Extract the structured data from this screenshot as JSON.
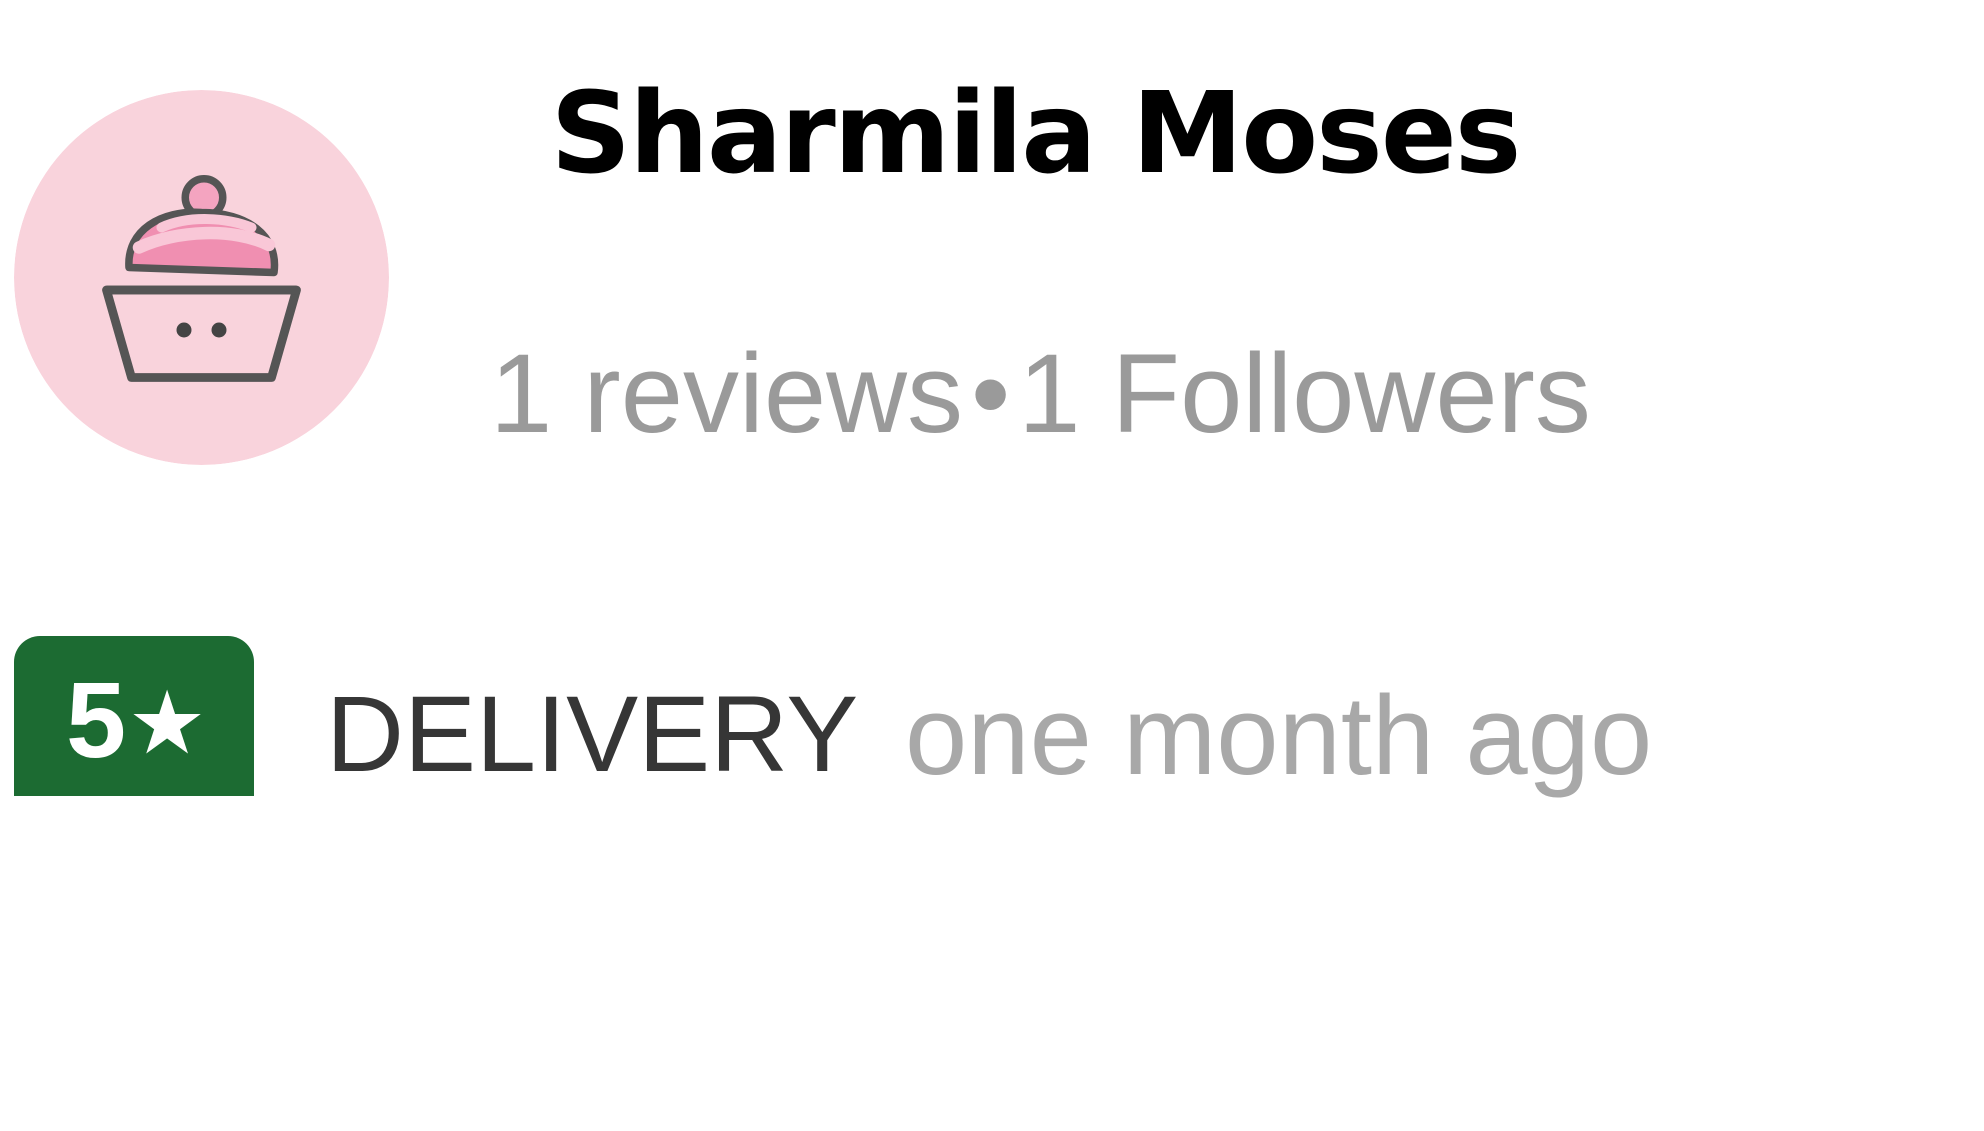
{
  "reviewer": {
    "name": "Sharmila Moses",
    "avatar_icon": "cupcake-icon",
    "stats": {
      "reviews": "1 reviews",
      "separator": "•",
      "followers": "1 Followers"
    }
  },
  "review": {
    "rating_value": "5",
    "rating_icon": "star-icon",
    "rating_color": "#1c6b32",
    "order_type": "DELIVERY",
    "time": "one month ago"
  }
}
